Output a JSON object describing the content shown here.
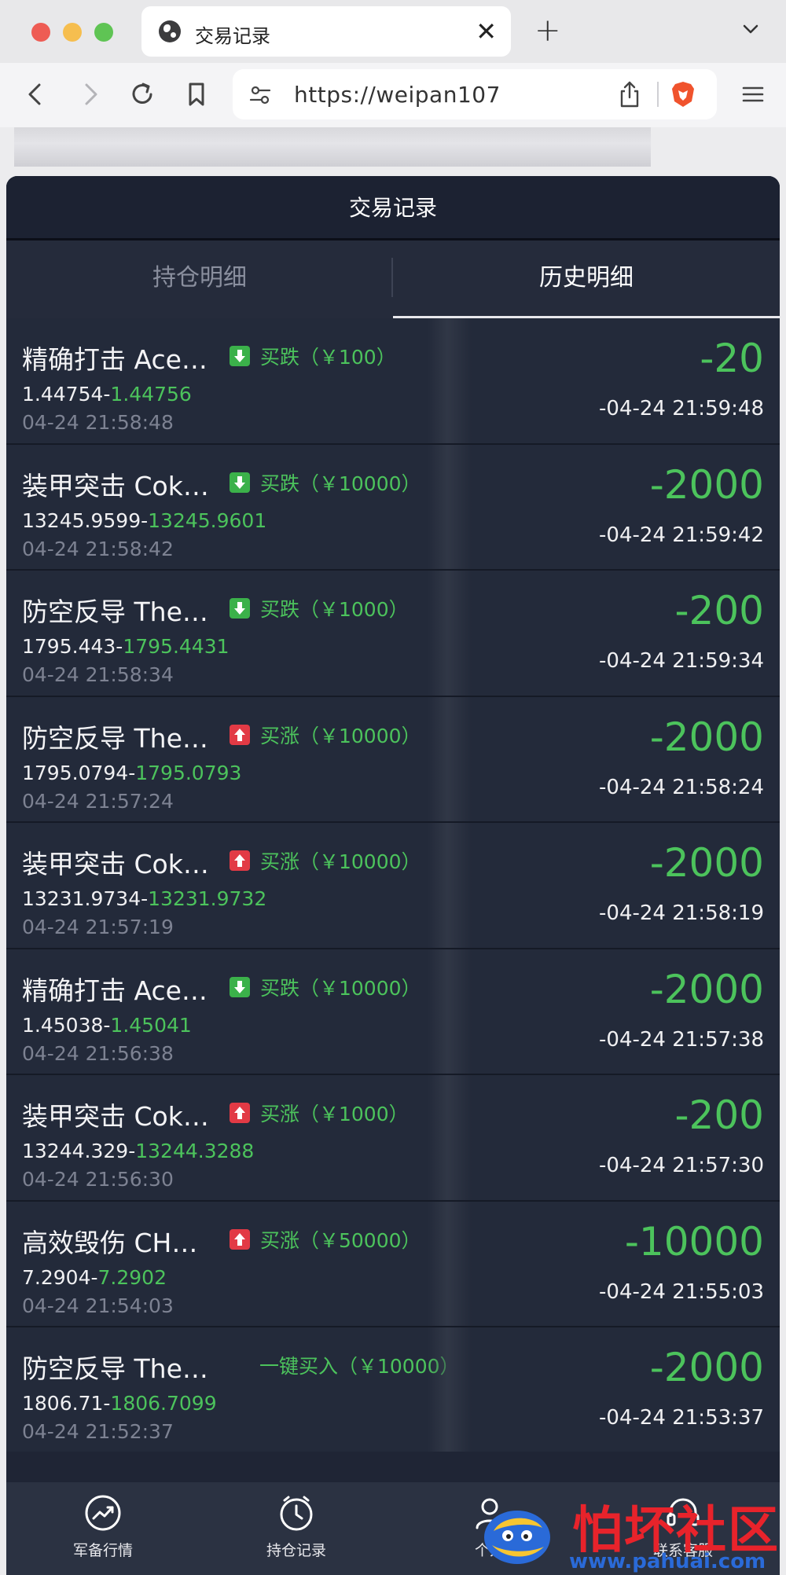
{
  "browser": {
    "tab_title": "交易记录",
    "new_tab_symbol": "+",
    "close_symbol": "✕",
    "url": "https://weipan107"
  },
  "app": {
    "header_title": "交易记录",
    "tabs": [
      {
        "label": "持仓明细",
        "active": false
      },
      {
        "label": "历史明细",
        "active": true
      }
    ]
  },
  "records": [
    {
      "name": "精确打击 Ace…",
      "direction": "down",
      "type": "买跌（￥100）",
      "open_price": "1.44754",
      "close_price": "1.44756",
      "open_time": "04-24 21:58:48",
      "pnl": "-20",
      "close_time": "-04-24 21:59:48"
    },
    {
      "name": "装甲突击 Cok…",
      "direction": "down",
      "type": "买跌（￥10000）",
      "open_price": "13245.9599",
      "close_price": "13245.9601",
      "open_time": "04-24 21:58:42",
      "pnl": "-2000",
      "close_time": "-04-24 21:59:42"
    },
    {
      "name": "防空反导 The…",
      "direction": "down",
      "type": "买跌（￥1000）",
      "open_price": "1795.443",
      "close_price": "1795.4431",
      "open_time": "04-24 21:58:34",
      "pnl": "-200",
      "close_time": "-04-24 21:59:34"
    },
    {
      "name": "防空反导 The…",
      "direction": "up",
      "type": "买涨（￥10000）",
      "open_price": "1795.0794",
      "close_price": "1795.0793",
      "open_time": "04-24 21:57:24",
      "pnl": "-2000",
      "close_time": "-04-24 21:58:24"
    },
    {
      "name": "装甲突击 Cok…",
      "direction": "up",
      "type": "买涨（￥10000）",
      "open_price": "13231.9734",
      "close_price": "13231.9732",
      "open_time": "04-24 21:57:19",
      "pnl": "-2000",
      "close_time": "-04-24 21:58:19"
    },
    {
      "name": "精确打击 Ace…",
      "direction": "down",
      "type": "买跌（￥10000）",
      "open_price": "1.45038",
      "close_price": "1.45041",
      "open_time": "04-24 21:56:38",
      "pnl": "-2000",
      "close_time": "-04-24 21:57:38"
    },
    {
      "name": "装甲突击 Cok…",
      "direction": "up",
      "type": "买涨（￥1000）",
      "open_price": "13244.329",
      "close_price": "13244.3288",
      "open_time": "04-24 21:56:30",
      "pnl": "-200",
      "close_time": "-04-24 21:57:30"
    },
    {
      "name": "高效毁伤 CH…",
      "direction": "up",
      "type": "买涨（￥50000）",
      "open_price": "7.2904",
      "close_price": "7.2902",
      "open_time": "04-24 21:54:03",
      "pnl": "-10000",
      "close_time": "-04-24 21:55:03"
    },
    {
      "name": "防空反导 The…",
      "direction": "none",
      "type": "一键买入（￥10000）",
      "open_price": "1806.71",
      "close_price": "1806.7099",
      "open_time": "04-24 21:52:37",
      "pnl": "-2000",
      "close_time": "-04-24 21:53:37"
    }
  ],
  "price_separator": "-",
  "bottom_nav": [
    {
      "label": "军备行情",
      "icon": "trend-icon"
    },
    {
      "label": "持仓记录",
      "icon": "clock-icon"
    },
    {
      "label": "个人",
      "icon": "user-icon"
    },
    {
      "label": "联系客服",
      "icon": "headset-icon"
    }
  ],
  "watermark": {
    "title": "怕坏社区",
    "url": "www.pahuai.com"
  },
  "colors": {
    "app_bg": "#1f2535",
    "row_bg": "#232a3a",
    "profit_green": "#4cc35c",
    "up_red": "#e23a45",
    "down_green": "#3bb14a"
  }
}
